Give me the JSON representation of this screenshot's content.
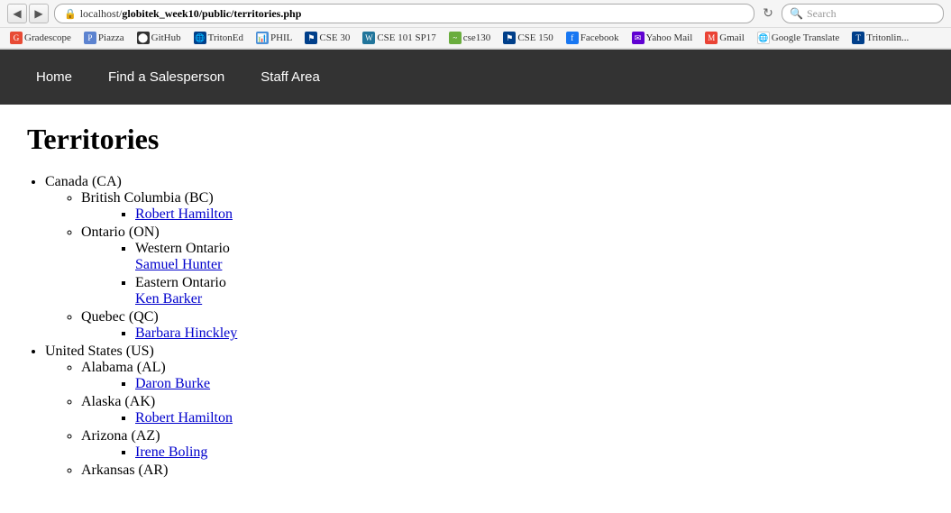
{
  "browser": {
    "back_icon": "◀",
    "forward_icon": "▶",
    "reload_icon": "↻",
    "address": {
      "prefix": "localhost/globitek_week10/public/",
      "page": "territories.php",
      "full": "localhost/globitek_week10/public/territories.php"
    },
    "search_placeholder": "Search"
  },
  "bookmarks": [
    {
      "id": "gradescope",
      "label": "Gradescope",
      "icon": "G",
      "class": "bk-gradescope"
    },
    {
      "id": "piazza",
      "label": "Piazza",
      "icon": "P",
      "class": "bk-piazza"
    },
    {
      "id": "github",
      "label": "GitHub",
      "icon": "🐙",
      "class": "bk-github"
    },
    {
      "id": "tritonlink",
      "label": "TritonEd",
      "icon": "T",
      "class": "bk-tritonlink"
    },
    {
      "id": "phil",
      "label": "PHIL",
      "icon": "📊",
      "class": "bk-phil"
    },
    {
      "id": "cse30",
      "label": "CSE 30",
      "icon": "⚑",
      "class": "bk-cse30"
    },
    {
      "id": "wp",
      "label": "CSE 101 SP17",
      "icon": "W",
      "class": "bk-wp"
    },
    {
      "id": "cse150",
      "label": "cse130",
      "icon": "~",
      "class": "bk-cse150"
    },
    {
      "id": "cse150b",
      "label": "CSE 150",
      "icon": "⚑",
      "class": "bk-cse30"
    },
    {
      "id": "facebook",
      "label": "Facebook",
      "icon": "f",
      "class": "bk-facebook"
    },
    {
      "id": "yahoo",
      "label": "Yahoo Mail",
      "icon": "Y",
      "class": "bk-yahoo"
    },
    {
      "id": "gmail",
      "label": "Gmail",
      "icon": "M",
      "class": "bk-gmail"
    },
    {
      "id": "google",
      "label": "Google Translate",
      "icon": "🌐",
      "class": "bk-google"
    },
    {
      "id": "triton",
      "label": "Tritonlin...",
      "icon": "T",
      "class": "bk-triton"
    }
  ],
  "nav": {
    "items": [
      {
        "id": "home",
        "label": "Home",
        "url": "#"
      },
      {
        "id": "find-salesperson",
        "label": "Find a Salesperson",
        "url": "#"
      },
      {
        "id": "staff-area",
        "label": "Staff Area",
        "url": "#"
      }
    ]
  },
  "page": {
    "title": "Territories",
    "territories": [
      {
        "id": "canada",
        "name": "Canada (CA)",
        "regions": [
          {
            "id": "bc",
            "name": "British Columbia (BC)",
            "territories": [
              {
                "id": "bc-rh",
                "name": "Robert Hamilton",
                "url": "#"
              }
            ]
          },
          {
            "id": "on",
            "name": "Ontario (ON)",
            "territories": [
              {
                "id": "on-western",
                "name": "Western Ontario",
                "salesperson": "Samuel Hunter",
                "url": "#"
              },
              {
                "id": "on-eastern",
                "name": "Eastern Ontario",
                "salesperson": "Ken Barker",
                "url": "#"
              }
            ]
          },
          {
            "id": "qc",
            "name": "Quebec (QC)",
            "territories": [
              {
                "id": "qc-bh",
                "name": "Barbara Hinckley",
                "url": "#"
              }
            ]
          }
        ]
      },
      {
        "id": "us",
        "name": "United States (US)",
        "regions": [
          {
            "id": "al",
            "name": "Alabama (AL)",
            "territories": [
              {
                "id": "al-db",
                "name": "Daron Burke",
                "url": "#"
              }
            ]
          },
          {
            "id": "ak",
            "name": "Alaska (AK)",
            "territories": [
              {
                "id": "ak-rh",
                "name": "Robert Hamilton",
                "url": "#"
              }
            ]
          },
          {
            "id": "az",
            "name": "Arizona (AZ)",
            "territories": [
              {
                "id": "az-ib",
                "name": "Irene Boling",
                "url": "#"
              }
            ]
          },
          {
            "id": "ar",
            "name": "Arkansas (AR)",
            "territories": []
          }
        ]
      }
    ]
  }
}
